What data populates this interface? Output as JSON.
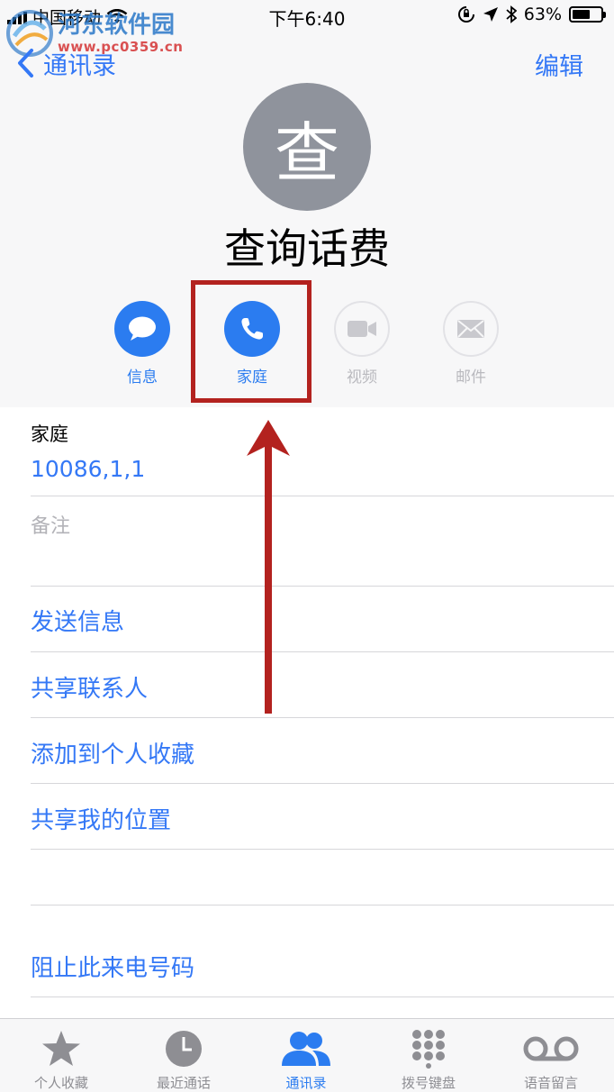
{
  "status_bar": {
    "carrier": "中国移动",
    "time": "下午6:40",
    "battery": "63%",
    "battery_level": 0.63
  },
  "watermark": {
    "title": "河东软件园",
    "url": "www.pc0359.cn"
  },
  "nav": {
    "back_label": "通讯录",
    "edit_label": "编辑"
  },
  "contact": {
    "avatar_initial": "查",
    "name": "查询话费"
  },
  "actions": [
    {
      "label": "信息",
      "icon": "message-bubble-icon",
      "state": "active"
    },
    {
      "label": "家庭",
      "icon": "phone-icon",
      "state": "active"
    },
    {
      "label": "视频",
      "icon": "video-camera-icon",
      "state": "disabled"
    },
    {
      "label": "邮件",
      "icon": "mail-icon",
      "state": "disabled"
    }
  ],
  "phone": {
    "label": "家庭",
    "number": "10086,1,1"
  },
  "notes_label": "备注",
  "list_actions": {
    "send_message": "发送信息",
    "share_contact": "共享联系人",
    "add_favorite": "添加到个人收藏",
    "share_location": "共享我的位置",
    "block_caller": "阻止此来电号码"
  },
  "tabs": [
    {
      "label": "个人收藏",
      "icon": "star-icon",
      "active": false
    },
    {
      "label": "最近通话",
      "icon": "clock-icon",
      "active": false
    },
    {
      "label": "通讯录",
      "icon": "contacts-icon",
      "active": true
    },
    {
      "label": "拨号键盘",
      "icon": "keypad-icon",
      "active": false
    },
    {
      "label": "语音留言",
      "icon": "voicemail-icon",
      "active": false
    }
  ],
  "colors": {
    "accent": "#3478f6",
    "highlight": "#b3221f",
    "avatar": "#8f939c"
  }
}
